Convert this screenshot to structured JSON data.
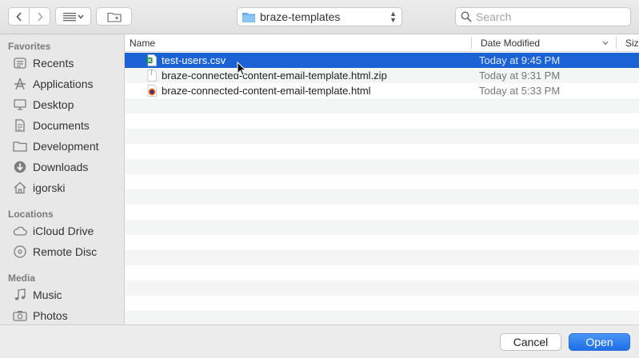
{
  "toolbar": {
    "path_label": "braze-templates",
    "search_placeholder": "Search"
  },
  "sidebar": {
    "sections": [
      {
        "title": "Favorites"
      },
      {
        "title": "Locations"
      },
      {
        "title": "Media"
      }
    ],
    "favorites": [
      {
        "label": "Recents",
        "icon": "clock-icon"
      },
      {
        "label": "Applications",
        "icon": "applications-icon"
      },
      {
        "label": "Desktop",
        "icon": "desktop-icon"
      },
      {
        "label": "Documents",
        "icon": "document-icon"
      },
      {
        "label": "Development",
        "icon": "folder-icon"
      },
      {
        "label": "Downloads",
        "icon": "download-icon"
      },
      {
        "label": "igorski",
        "icon": "home-icon"
      }
    ],
    "locations": [
      {
        "label": "iCloud Drive",
        "icon": "cloud-icon"
      },
      {
        "label": "Remote Disc",
        "icon": "disc-icon"
      }
    ],
    "media": [
      {
        "label": "Music",
        "icon": "music-icon"
      },
      {
        "label": "Photos",
        "icon": "camera-icon"
      }
    ]
  },
  "list": {
    "columns": [
      "Name",
      "Date Modified",
      "Siz"
    ],
    "files": [
      {
        "name": "test-users.csv",
        "date": "Today at 9:45 PM",
        "icon": "csv-file-icon",
        "selected": true
      },
      {
        "name": "braze-connected-content-email-template.html.zip",
        "date": "Today at 9:31 PM",
        "icon": "zip-file-icon",
        "selected": false
      },
      {
        "name": "braze-connected-content-email-template.html",
        "date": "Today at 5:33 PM",
        "icon": "html-file-icon",
        "selected": false
      }
    ]
  },
  "footer": {
    "cancel_label": "Cancel",
    "open_label": "Open"
  },
  "colors": {
    "selection": "#1b63d5",
    "primary_button": "#1e6ee8"
  }
}
